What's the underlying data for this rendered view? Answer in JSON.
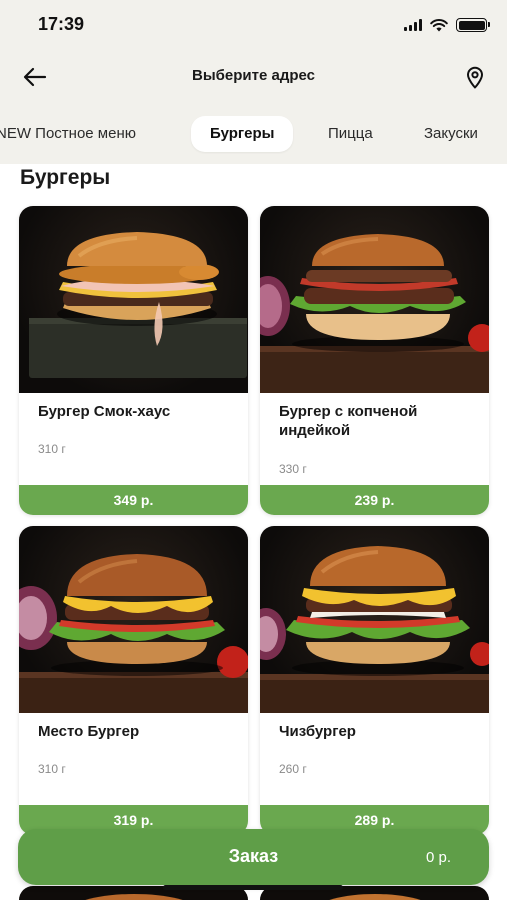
{
  "status_bar": {
    "time": "17:39"
  },
  "header": {
    "title": "Выберите адрес",
    "back_icon": "arrow-left-icon",
    "location_icon": "location-pin-icon"
  },
  "tabs": [
    {
      "label": "NEW Постное меню",
      "active": false
    },
    {
      "label": "Бургеры",
      "active": true
    },
    {
      "label": "Пицца",
      "active": false
    },
    {
      "label": "Закуски",
      "active": false
    }
  ],
  "section": {
    "title": "Бургеры"
  },
  "products": [
    {
      "name": "Бургер Смок-хаус",
      "weight": "310 г",
      "price": "349 р."
    },
    {
      "name": "Бургер с копченой индейкой",
      "weight": "330 г",
      "price": "239 р."
    },
    {
      "name": "Место Бургер",
      "weight": "310 г",
      "price": "319 р."
    },
    {
      "name": "Чизбургер",
      "weight": "260 г",
      "price": "289 р."
    }
  ],
  "order": {
    "label": "Заказ",
    "total": "0 р."
  },
  "colors": {
    "accent_green": "#6aa84f",
    "order_green": "#5f9e48",
    "background": "#f2f1ec"
  }
}
